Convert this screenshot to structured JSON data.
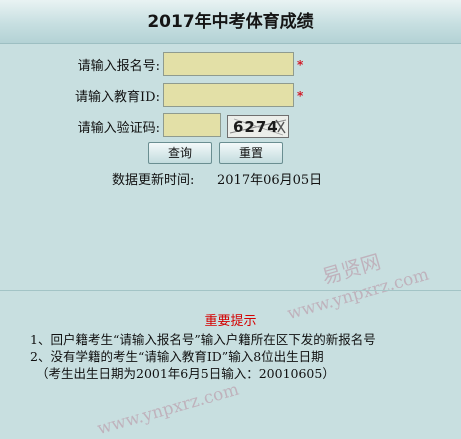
{
  "header": {
    "title": "2017年中考体育成绩"
  },
  "form": {
    "exam_no_label": "请输入报名号:",
    "exam_no_value": "",
    "edu_id_label": "请输入教育ID:",
    "edu_id_value": "",
    "captcha_label": "请输入验证码:",
    "captcha_value": "",
    "captcha_text": "6274",
    "required_mark": "*"
  },
  "buttons": {
    "query": "查询",
    "reset": "重置"
  },
  "update": {
    "label": "数据更新时间:",
    "date": "2017年06月05日"
  },
  "watermark": {
    "cn": "易贤网",
    "url": "www.ynpxrz.com"
  },
  "notice": {
    "title": "重要提示",
    "lines": [
      "1、回户籍考生“请输入报名号”输入户籍所在区下发的新报名号",
      "2、没有学籍的考生“请输入教育ID”输入8位出生日期",
      "（考生出生日期为2001年6月5日输入：20010605）"
    ]
  },
  "colors": {
    "background": "#c8dfe0",
    "input_fill": "#e3e0a7",
    "required": "#d2000f",
    "notice_title": "#d40000"
  }
}
